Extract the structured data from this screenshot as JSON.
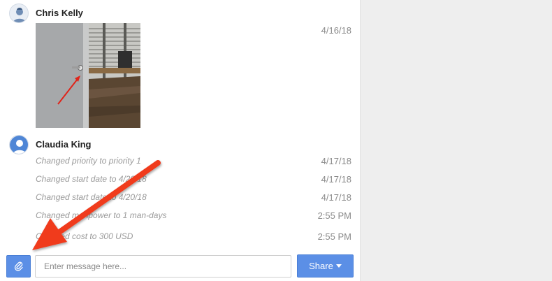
{
  "messages": [
    {
      "author": "Chris Kelly",
      "date": "4/16/18",
      "attachment": {
        "type": "photo"
      }
    },
    {
      "author": "Claudia King",
      "activities": [
        {
          "text": "Changed priority to priority 1",
          "time": "4/17/18"
        },
        {
          "text": "Changed start date to 4/20/18",
          "time": "4/17/18"
        },
        {
          "text": "Changed start date to 4/20/18",
          "time": "4/17/18"
        },
        {
          "text": "Changed manpower to 1 man-days",
          "time": "2:55 PM"
        },
        {
          "text": "Changed cost to 300 USD",
          "time": "2:55 PM"
        }
      ]
    }
  ],
  "composer": {
    "placeholder": "Enter message here...",
    "share_label": "Share",
    "attach_icon": "paperclip-icon",
    "share_caret_icon": "caret-down-icon"
  },
  "colors": {
    "accent": "#5b8fe6",
    "annotation_arrow": "#f03a1f",
    "side_panel": "#eeeeee"
  }
}
